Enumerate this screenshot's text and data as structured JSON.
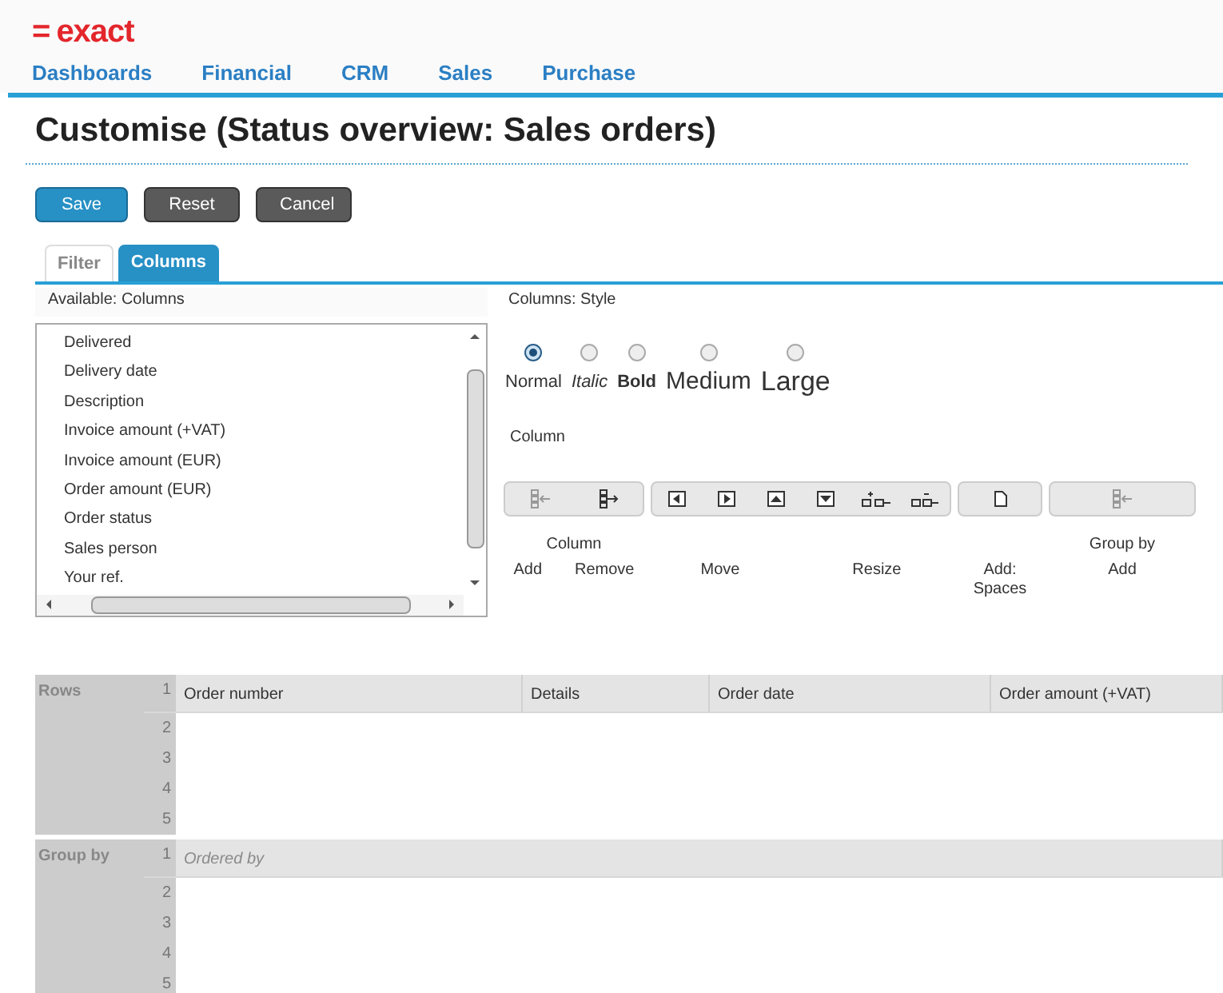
{
  "logo": {
    "mark": "=",
    "text": "exact"
  },
  "nav": [
    "Dashboards",
    "Financial",
    "CRM",
    "Sales",
    "Purchase"
  ],
  "title": "Customise (Status overview: Sales orders)",
  "buttons": [
    {
      "label": "Save",
      "kind": "primary"
    },
    {
      "label": "Reset",
      "kind": "secondary"
    },
    {
      "label": "Cancel",
      "kind": "secondary"
    }
  ],
  "tabs": [
    {
      "label": "Filter",
      "selected": false
    },
    {
      "label": "Columns",
      "selected": true
    }
  ],
  "available": {
    "label": "Available: Columns",
    "items": [
      "Delivered",
      "Delivery date",
      "Description",
      "Invoice amount (+VAT)",
      "Invoice amount (EUR)",
      "Order amount (EUR)",
      "Order status",
      "Sales person",
      "Your ref."
    ]
  },
  "style": {
    "label": "Columns: Style",
    "options": [
      {
        "label": "Normal",
        "kind": "normal",
        "selected": true
      },
      {
        "label": "Italic",
        "kind": "italic",
        "selected": false
      },
      {
        "label": "Bold",
        "kind": "bold",
        "selected": false
      },
      {
        "label": "Medium",
        "kind": "medium",
        "selected": false
      },
      {
        "label": "Large",
        "kind": "large",
        "selected": false
      }
    ],
    "column_label": "Column"
  },
  "toolbar": {
    "groups": [
      {
        "kind": "column",
        "caption": "Column",
        "labels": [
          "Add",
          "Remove"
        ]
      },
      {
        "kind": "move",
        "labels": [
          "Move",
          "Resize"
        ]
      },
      {
        "kind": "spaces",
        "labels": [
          "Add: Spaces"
        ]
      },
      {
        "kind": "group",
        "caption": "Group by",
        "labels": [
          "Add"
        ]
      }
    ]
  },
  "sections": [
    {
      "label": "Rows",
      "lines": [
        {
          "number": "1",
          "cells": [
            {
              "text": "Order number",
              "disabled": false
            },
            {
              "text": "Details",
              "disabled": false
            },
            {
              "text": "Order date",
              "disabled": false
            },
            {
              "text": "Order amount (+VAT)",
              "disabled": false
            }
          ]
        },
        {
          "number": "2"
        },
        {
          "number": "3"
        },
        {
          "number": "4"
        },
        {
          "number": "5"
        }
      ]
    },
    {
      "label": "Group by",
      "lines": [
        {
          "number": "1",
          "cells": [
            {
              "text": "Ordered by",
              "disabled": true
            }
          ]
        },
        {
          "number": "2"
        },
        {
          "number": "3"
        },
        {
          "number": "4"
        },
        {
          "number": "5"
        }
      ]
    }
  ]
}
